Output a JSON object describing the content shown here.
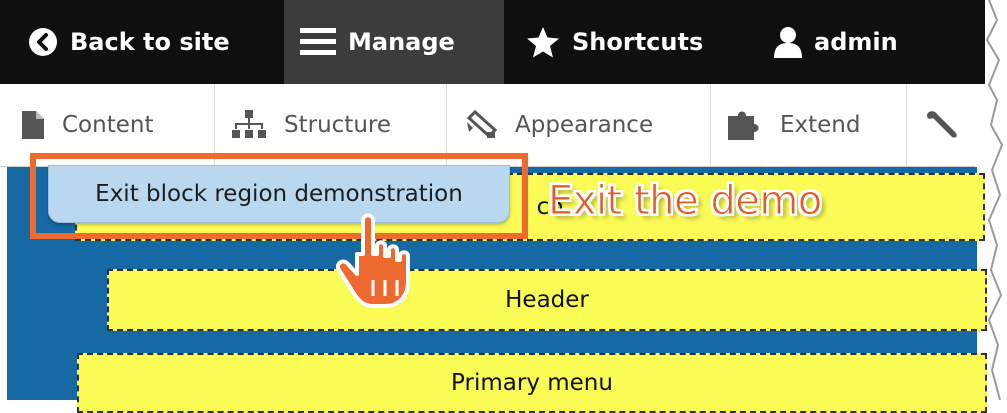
{
  "toolbar": {
    "back_label": "Back to site",
    "manage_label": "Manage",
    "shortcuts_label": "Shortcuts",
    "user_label": "admin",
    "icons": [
      "back-circle-icon",
      "hamburger-icon",
      "star-icon",
      "user-icon"
    ]
  },
  "tray": {
    "items": [
      {
        "label": "Content",
        "icon": "file-icon"
      },
      {
        "label": "Structure",
        "icon": "sitemap-icon"
      },
      {
        "label": "Appearance",
        "icon": "paint-icon"
      },
      {
        "label": "Extend",
        "icon": "puzzle-icon"
      },
      {
        "label": "",
        "icon": "wrench-icon"
      }
    ]
  },
  "demo": {
    "exit_button_label": "Exit block region demonstration",
    "region_top_peek": "co",
    "regions": [
      "Header",
      "Primary menu"
    ]
  },
  "annotation": {
    "callout_text": "Exit the demo",
    "callout_color": "#e45a25",
    "highlight_color": "#ef6a2f"
  },
  "colors": {
    "toolbar_bg": "#0f0f0f",
    "manage_bg": "#3c3c3c",
    "demo_bg": "#1769a4",
    "region_bg": "#fbfb55",
    "exit_button_bg": "#b9d8ef"
  }
}
